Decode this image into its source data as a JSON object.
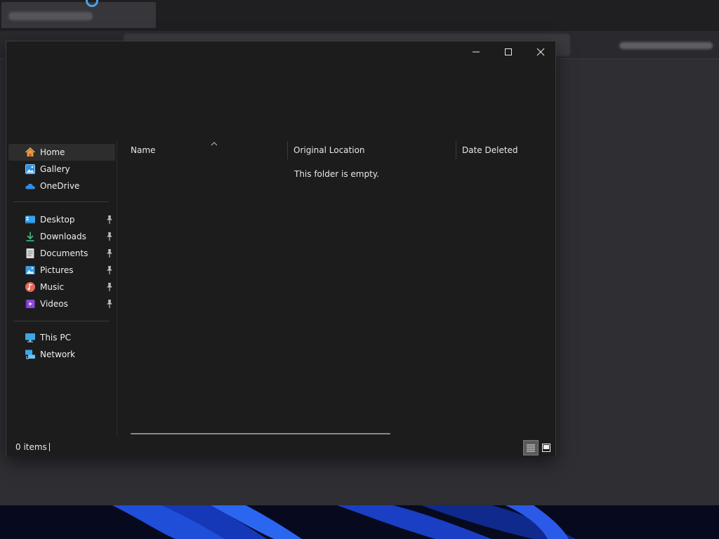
{
  "window": {
    "caption": {
      "minimize_icon": "minimize-icon",
      "maximize_icon": "maximize-icon",
      "close_icon": "close-icon"
    }
  },
  "nav": {
    "quick": [
      {
        "label": "Home",
        "icon": "home-icon",
        "selected": true
      },
      {
        "label": "Gallery",
        "icon": "gallery-icon"
      },
      {
        "label": "OneDrive",
        "icon": "onedrive-icon"
      }
    ],
    "pinned": [
      {
        "label": "Desktop",
        "icon": "desktop-icon"
      },
      {
        "label": "Downloads",
        "icon": "downloads-icon"
      },
      {
        "label": "Documents",
        "icon": "documents-icon"
      },
      {
        "label": "Pictures",
        "icon": "pictures-icon"
      },
      {
        "label": "Music",
        "icon": "music-icon"
      },
      {
        "label": "Videos",
        "icon": "videos-icon"
      }
    ],
    "devices": [
      {
        "label": "This PC",
        "icon": "this-pc-icon"
      },
      {
        "label": "Network",
        "icon": "network-icon"
      }
    ]
  },
  "list": {
    "columns": [
      "Name",
      "Original Location",
      "Date Deleted"
    ],
    "empty_message": "This folder is empty."
  },
  "status": {
    "item_count": "0 items"
  },
  "colors": {
    "window_bg": "#1c1c1c",
    "accent_blue": "#4aa3e8",
    "text": "#e8e8e8"
  }
}
